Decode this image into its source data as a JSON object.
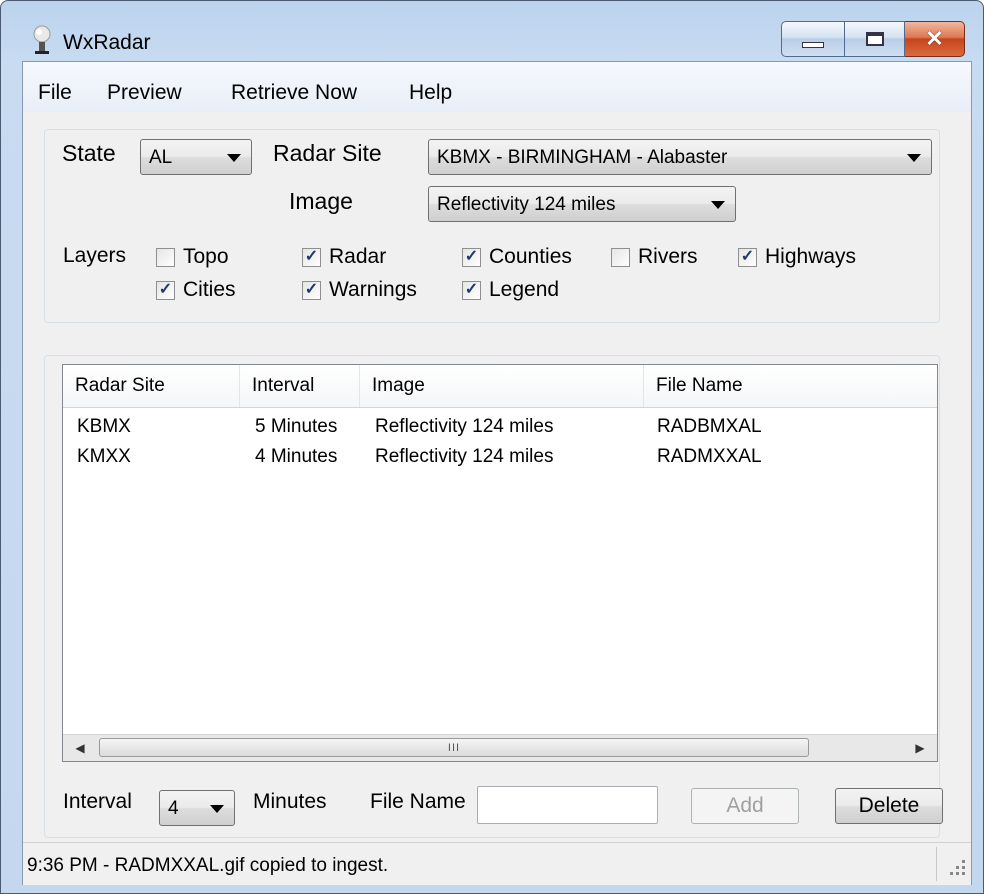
{
  "window": {
    "title": "WxRadar",
    "controls": {
      "minimize_icon": "minimize-icon",
      "maximize_icon": "restore-icon",
      "close_icon": "close-icon"
    }
  },
  "menu": {
    "items": [
      "File",
      "Preview",
      "Retrieve Now",
      "Help"
    ]
  },
  "settings": {
    "state_label": "State",
    "state_value": "AL",
    "radar_site_label": "Radar Site",
    "radar_site_value": "KBMX - BIRMINGHAM - Alabaster",
    "image_label": "Image",
    "image_value": "Reflectivity 124 miles",
    "layers_label": "Layers",
    "layers": [
      {
        "label": "Topo",
        "checked": false
      },
      {
        "label": "Cities",
        "checked": true
      },
      {
        "label": "Radar",
        "checked": true
      },
      {
        "label": "Warnings",
        "checked": true
      },
      {
        "label": "Counties",
        "checked": true
      },
      {
        "label": "Legend",
        "checked": true
      },
      {
        "label": "Rivers",
        "checked": false
      },
      {
        "label": "Highways",
        "checked": true
      }
    ]
  },
  "list": {
    "columns": [
      "Radar Site",
      "Interval",
      "Image",
      "File Name"
    ],
    "rows": [
      [
        "KBMX",
        "5 Minutes",
        "Reflectivity 124 miles",
        "RADBMXAL"
      ],
      [
        "KMXX",
        "4 Minutes",
        "Reflectivity 124 miles",
        "RADMXXAL"
      ]
    ],
    "scroll_thumb_text": "III"
  },
  "bottom": {
    "interval_label": "Interval",
    "interval_value": "4",
    "minutes_label": "Minutes",
    "file_name_label": "File Name",
    "file_name_value": "",
    "add_label": "Add",
    "delete_label": "Delete"
  },
  "status": {
    "text": "9:36 PM - RADMXXAL.gif copied to ingest."
  },
  "colors": {
    "title_bar": "#c3d7ef",
    "client_bg": "#f0f0f0",
    "close_button": "#c8441d"
  }
}
